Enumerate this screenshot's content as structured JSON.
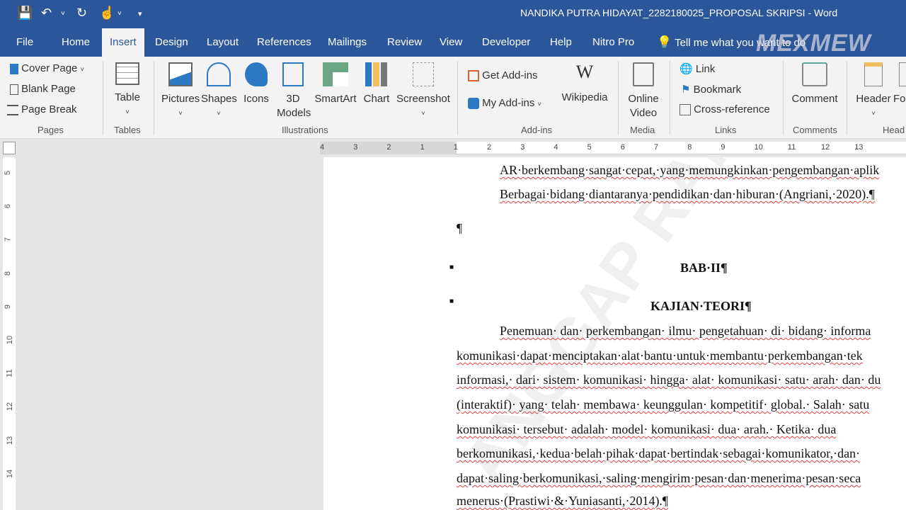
{
  "window": {
    "title": "NANDIKA PUTRA HIDAYAT_2282180025_PROPOSAL SKRIPSI  -  Word"
  },
  "qat": {
    "save": "save-icon",
    "undo": "undo-icon",
    "redo": "redo-icon",
    "touch": "touch-mode-icon",
    "customize": "customize-icon"
  },
  "tabs": [
    "File",
    "Home",
    "Insert",
    "Design",
    "Layout",
    "References",
    "Mailings",
    "Review",
    "View",
    "Developer",
    "Help",
    "Nitro Pro"
  ],
  "active_tab": "Insert",
  "tell_me": "Tell me what you want to do",
  "watermark": "MEXMEW",
  "ribbon": {
    "pages": {
      "cover": "Cover Page",
      "blank": "Blank Page",
      "break": "Page Break",
      "label": "Pages"
    },
    "tables": {
      "table": "Table",
      "label": "Tables"
    },
    "illustrations": {
      "pictures": "Pictures",
      "shapes": "Shapes",
      "icons": "Icons",
      "models1": "3D",
      "models2": "Models",
      "smartart": "SmartArt",
      "chart": "Chart",
      "screenshot": "Screenshot",
      "label": "Illustrations"
    },
    "addins": {
      "get": "Get Add-ins",
      "my": "My Add-ins",
      "wiki_logo": "W",
      "wiki": "Wikipedia",
      "label": "Add-ins"
    },
    "media": {
      "v1": "Online",
      "v2": "Video",
      "label": "Media"
    },
    "links": {
      "link": "Link",
      "bookmark": "Bookmark",
      "cross": "Cross-reference",
      "label": "Links"
    },
    "comments": {
      "comment": "Comment",
      "label": "Comments"
    },
    "header": {
      "header": "Header",
      "footer": "Fo",
      "label": "Head"
    }
  },
  "ruler": {
    "ticks": [
      "4",
      "3",
      "2",
      "1",
      "1",
      "2",
      "3",
      "4",
      "5",
      "6",
      "7",
      "8",
      "9",
      "10",
      "11",
      "12",
      "13"
    ],
    "vticks": [
      "5",
      "6",
      "7",
      "8",
      "9",
      "10",
      "11",
      "12",
      "13",
      "14"
    ]
  },
  "doc": {
    "l1": "AR·berkembang·sangat·cepat,·yang·memungkinkan·pengembangan·aplik",
    "l2": "Berbagai·bidang·diantaranya·pendidikan·dan·hiburan·(Angriani,·2020).¶",
    "empty": "¶",
    "h1": "BAB·II¶",
    "h2": "KAJIAN·TEORI¶",
    "p1": "Penemuan· dan· perkembangan· ilmu· pengetahuan· di· bidang· informa",
    "p2": "komunikasi·dapat·menciptakan·alat·bantu·untuk·membantu·perkembangan·tek",
    "p3": "informasi,· dari· sistem· komunikasi· hingga· alat· komunikasi· satu· arah· dan· du",
    "p4": "(interaktif)· yang· telah· membawa· keunggulan· kompetitif· global.· Salah· satu",
    "p5": "komunikasi· tersebut· adalah· model· komunikasi· dua· arah.· Ketika· dua",
    "p6": "berkomunikasi,·kedua·belah·pihak·dapat·bertindak·sebagai·komunikator,·dan·",
    "p7": "dapat·saling·berkomunikasi,·saling·mengirim·pesan·dan·menerima·pesan·seca",
    "p8": "menerus·(Prastiwi·&·Yuniasanti,·2014).¶"
  },
  "diag_watermark": "ANGGAP RAHASIA",
  "colors": {
    "accent": "#2b579a"
  }
}
